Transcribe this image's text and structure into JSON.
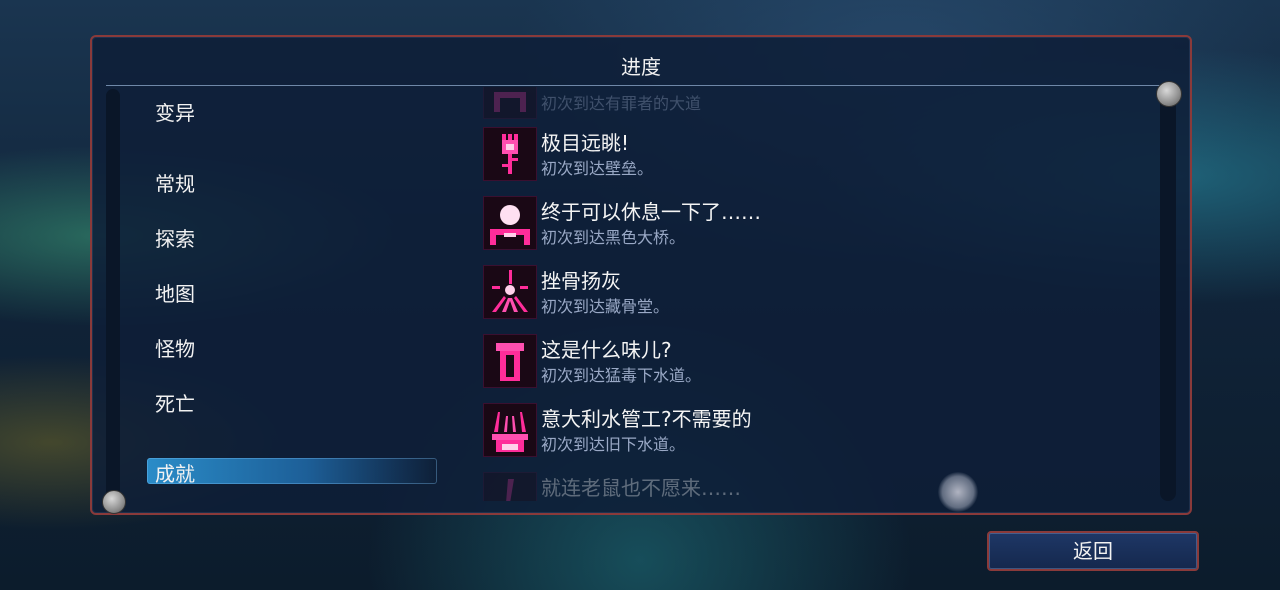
{
  "panel": {
    "title": "进度"
  },
  "categories": [
    {
      "label": "变异",
      "selected": false
    },
    {
      "label": "常规",
      "selected": false
    },
    {
      "label": "探索",
      "selected": false
    },
    {
      "label": "地图",
      "selected": false
    },
    {
      "label": "怪物",
      "selected": false
    },
    {
      "label": "死亡",
      "selected": false
    },
    {
      "label": "成就",
      "selected": true
    }
  ],
  "achievements": [
    {
      "name": "",
      "desc": "初次到达有罪者的大道",
      "icon": "gate-icon"
    },
    {
      "name": "极目远眺!",
      "desc": "初次到达壁垒。",
      "icon": "tower-icon"
    },
    {
      "name": "终于可以休息一下了……",
      "desc": "初次到达黑色大桥。",
      "icon": "bridge-icon"
    },
    {
      "name": "挫骨扬灰",
      "desc": "初次到达藏骨堂。",
      "icon": "ossuary-icon"
    },
    {
      "name": "这是什么味儿?",
      "desc": "初次到达猛毒下水道。",
      "icon": "sewer-pipe-icon"
    },
    {
      "name": "意大利水管工?不需要的",
      "desc": "初次到达旧下水道。",
      "icon": "old-sewer-icon"
    },
    {
      "name": "就连老鼠也不愿来……",
      "desc": "",
      "icon": "rat-icon"
    }
  ],
  "back_button": {
    "label": "返回"
  },
  "colors": {
    "accent": "#e0147a",
    "panel_border": "#8a3a3a",
    "selected": "#2a8cc8"
  }
}
